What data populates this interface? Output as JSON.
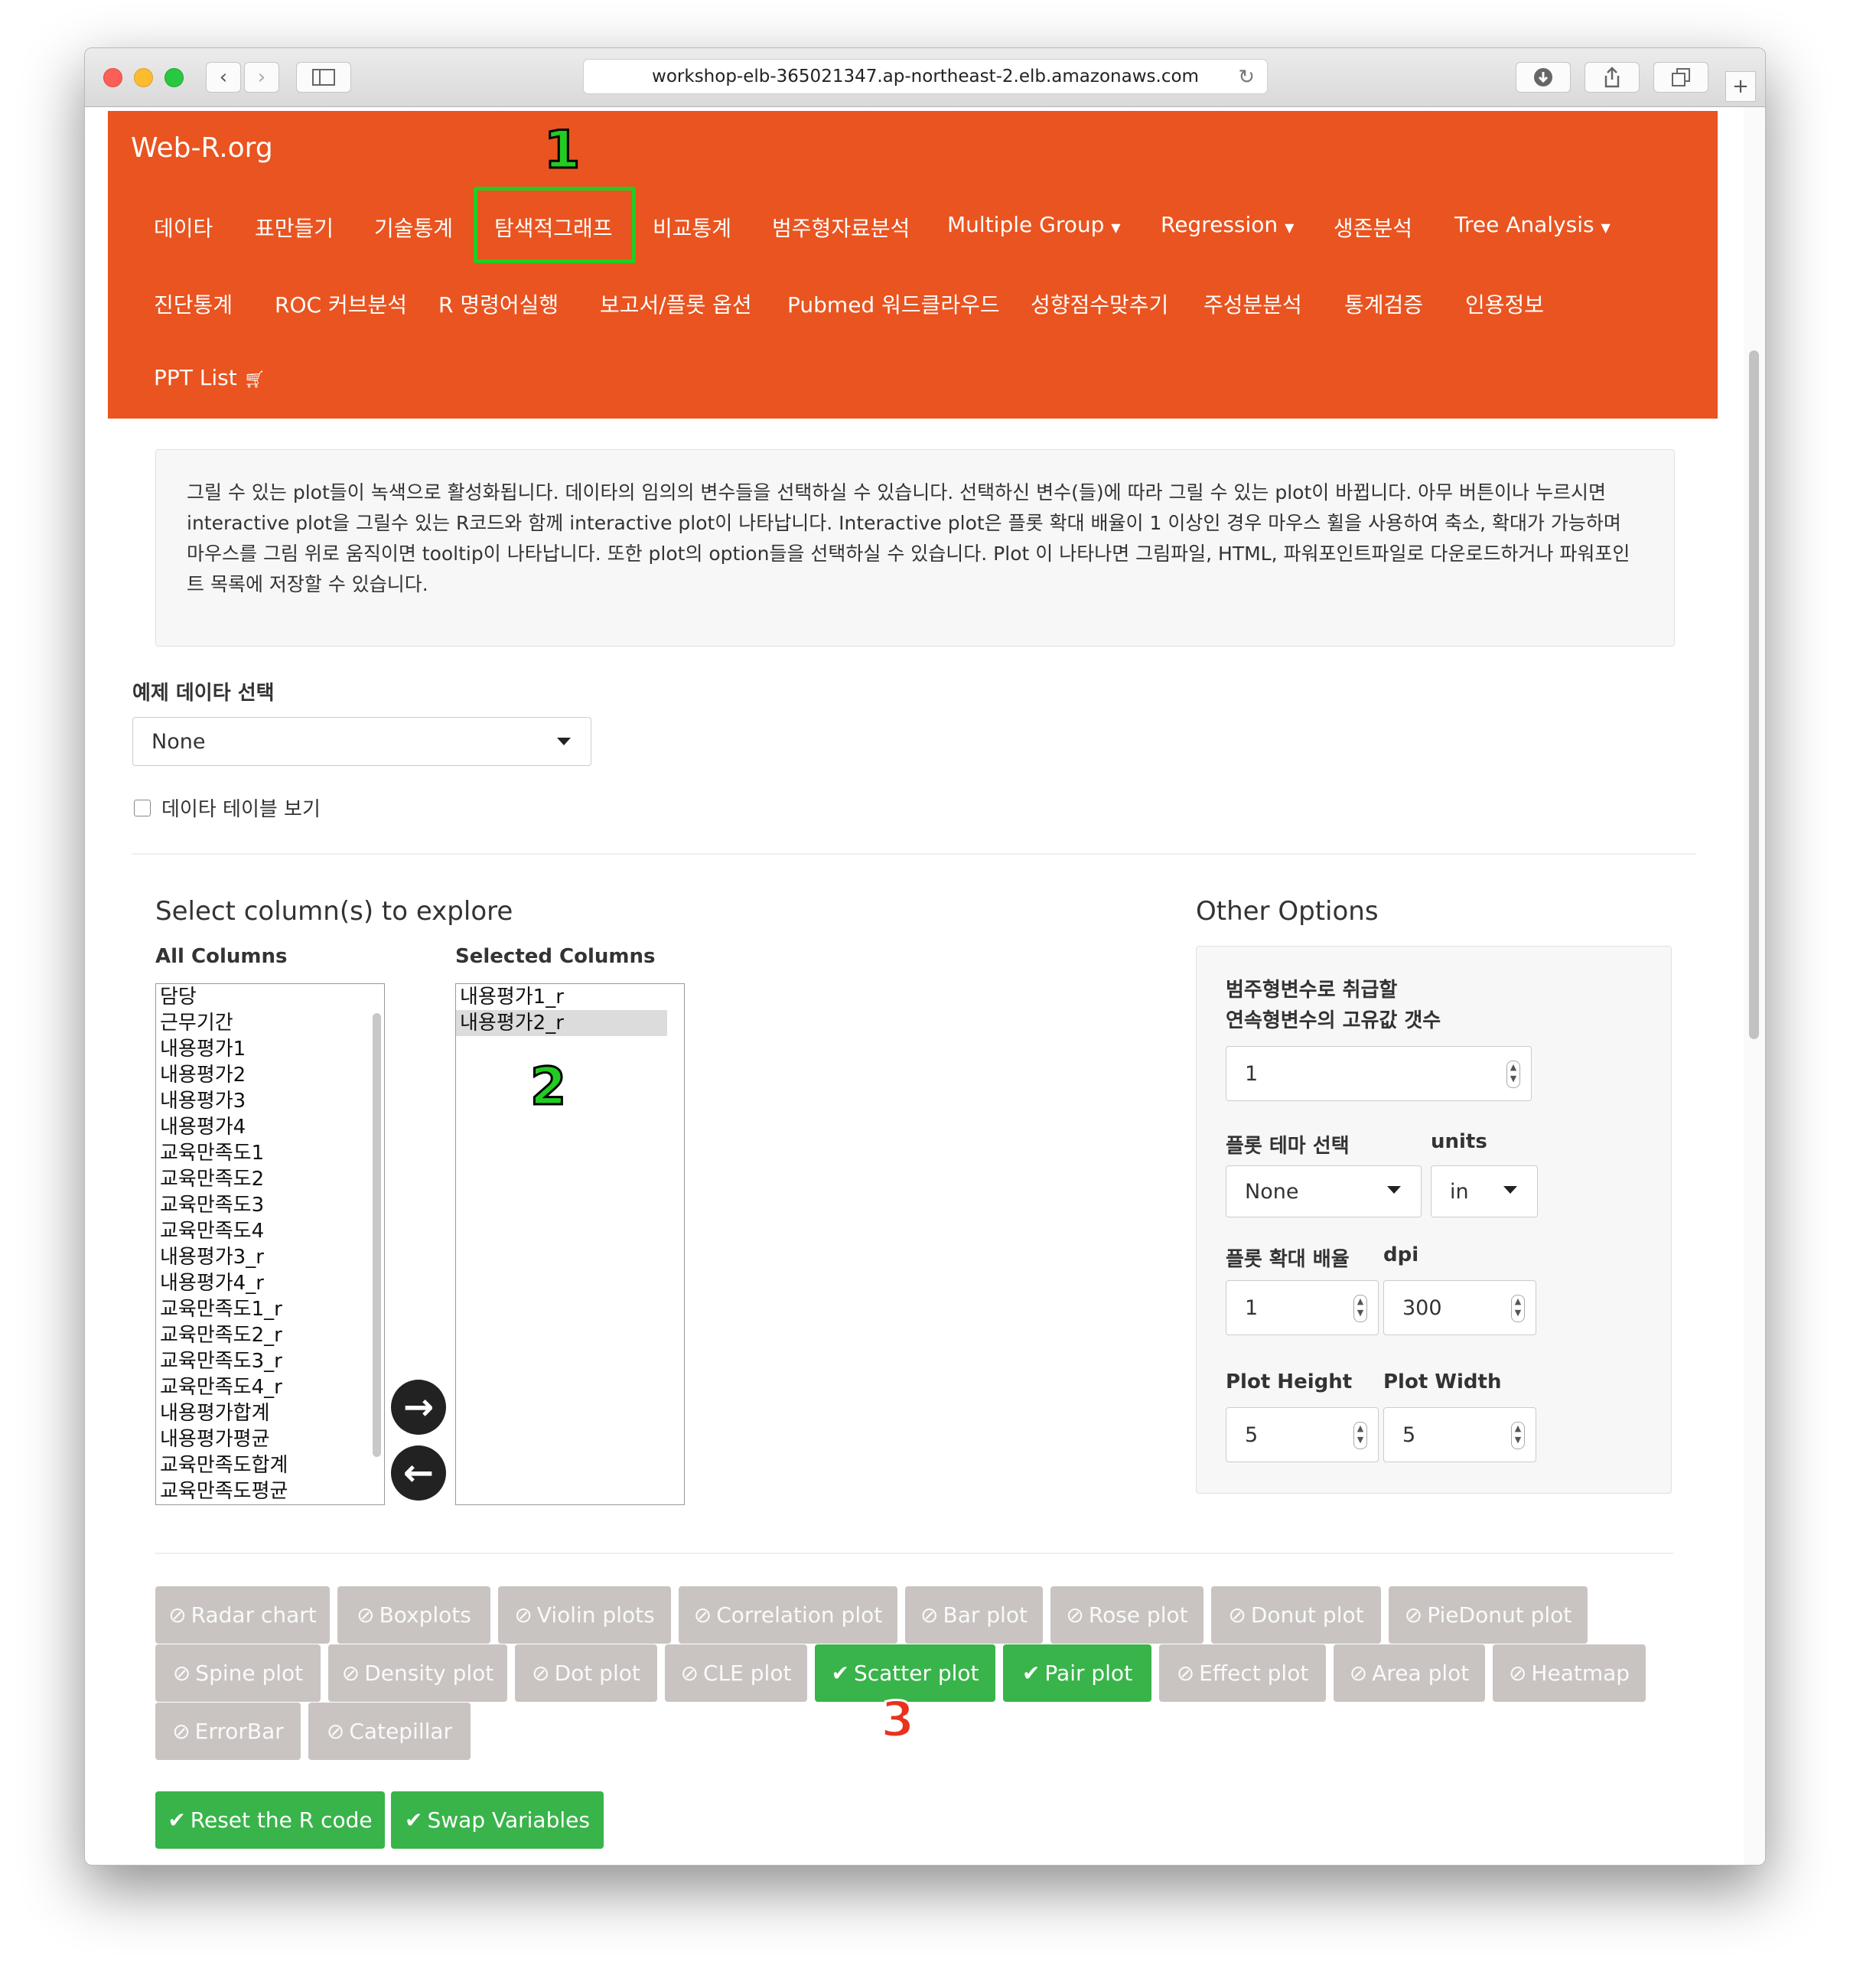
{
  "browser": {
    "url": "workshop-elb-365021347.ap-northeast-2.elb.amazonaws.com"
  },
  "brand": "Web-R.org",
  "nav": {
    "row1": [
      "데이타",
      "표만들기",
      "기술통계",
      "탐색적그래프",
      "비교통계",
      "범주형자료분석",
      "Multiple Group",
      "Regression",
      "생존분석",
      "Tree Analysis"
    ],
    "row2": [
      "진단통계",
      "ROC 커브분석",
      "R 명령어실행",
      "보고서/플롯 옵션",
      "Pubmed 워드클라우드",
      "성향점수맞추기",
      "주성분분석",
      "통계검증",
      "인용정보"
    ],
    "row3": [
      "PPT List"
    ],
    "active": "탐색적그래프"
  },
  "annotations": [
    "1",
    "2",
    "3"
  ],
  "description": "그릴 수 있는 plot들이 녹색으로 활성화됩니다. 데이타의 임의의 변수들을 선택하실 수 있습니다. 선택하신 변수(들)에 따라 그릴 수 있는 plot이 바뀝니다. 아무 버튼이나 누르시면 interactive plot을 그릴수 있는 R코드와 함께 interactive plot이 나타납니다. Interactive plot은 플롯 확대 배율이 1 이상인 경우 마우스 휠을 사용하여 축소, 확대가 가능하며 마우스를 그림 위로 움직이면 tooltip이 나타납니다. 또한 plot의 option들을 선택하실 수 있습니다. Plot 이 나타나면 그림파일, HTML, 파워포인트파일로 다운로드하거나 파워포인트 목록에 저장할 수 있습니다.",
  "example_data": {
    "label": "예제 데이타 선택",
    "value": "None",
    "show_table_label": "데이타 테이블 보기"
  },
  "columns": {
    "heading": "Select column(s) to explore",
    "all_label": "All Columns",
    "selected_label": "Selected Columns",
    "all": [
      "담당",
      "근무기간",
      "내용평가1",
      "내용평가2",
      "내용평가3",
      "내용평가4",
      "교육만족도1",
      "교육만족도2",
      "교육만족도3",
      "교육만족도4",
      "내용평가3_r",
      "내용평가4_r",
      "교육만족도1_r",
      "교육만족도2_r",
      "교육만족도3_r",
      "교육만족도4_r",
      "내용평가합계",
      "내용평가평균",
      "교육만족도합계",
      "교육만족도평균"
    ],
    "selected": [
      "내용평가1_r",
      "내용평가2_r"
    ]
  },
  "options": {
    "heading": "Other Options",
    "unique_label_line1": "범주형변수로 취급할",
    "unique_label_line2": "연속형변수의 고유값 갯수",
    "unique_value": "1",
    "theme_label": "플롯 테마 선택",
    "theme_value": "None",
    "units_label": "units",
    "units_value": "in",
    "zoom_label": "플롯 확대 배율",
    "zoom_value": "1",
    "dpi_label": "dpi",
    "dpi_value": "300",
    "height_label": "Plot Height",
    "height_value": "5",
    "width_label": "Plot Width",
    "width_value": "5"
  },
  "plot_buttons": {
    "row1": [
      "Radar chart",
      "Boxplots",
      "Violin plots",
      "Correlation plot",
      "Bar plot",
      "Rose plot",
      "Donut plot",
      "PieDonut plot"
    ],
    "row2": [
      "Spine plot",
      "Density plot",
      "Dot plot",
      "CLE plot",
      "Scatter plot",
      "Pair plot",
      "Effect plot",
      "Area plot",
      "Heatmap"
    ],
    "row3": [
      "ErrorBar",
      "Catepillar"
    ],
    "enabled": [
      "Scatter plot",
      "Pair plot"
    ]
  },
  "actions": {
    "reset": "Reset the R code",
    "swap": "Swap Variables"
  },
  "colors": {
    "navbar": "#e95420",
    "success": "#38b44a",
    "disabled": "#c9c4c1",
    "annotation_green": "#22cc22",
    "annotation_red": "#e8321e"
  }
}
